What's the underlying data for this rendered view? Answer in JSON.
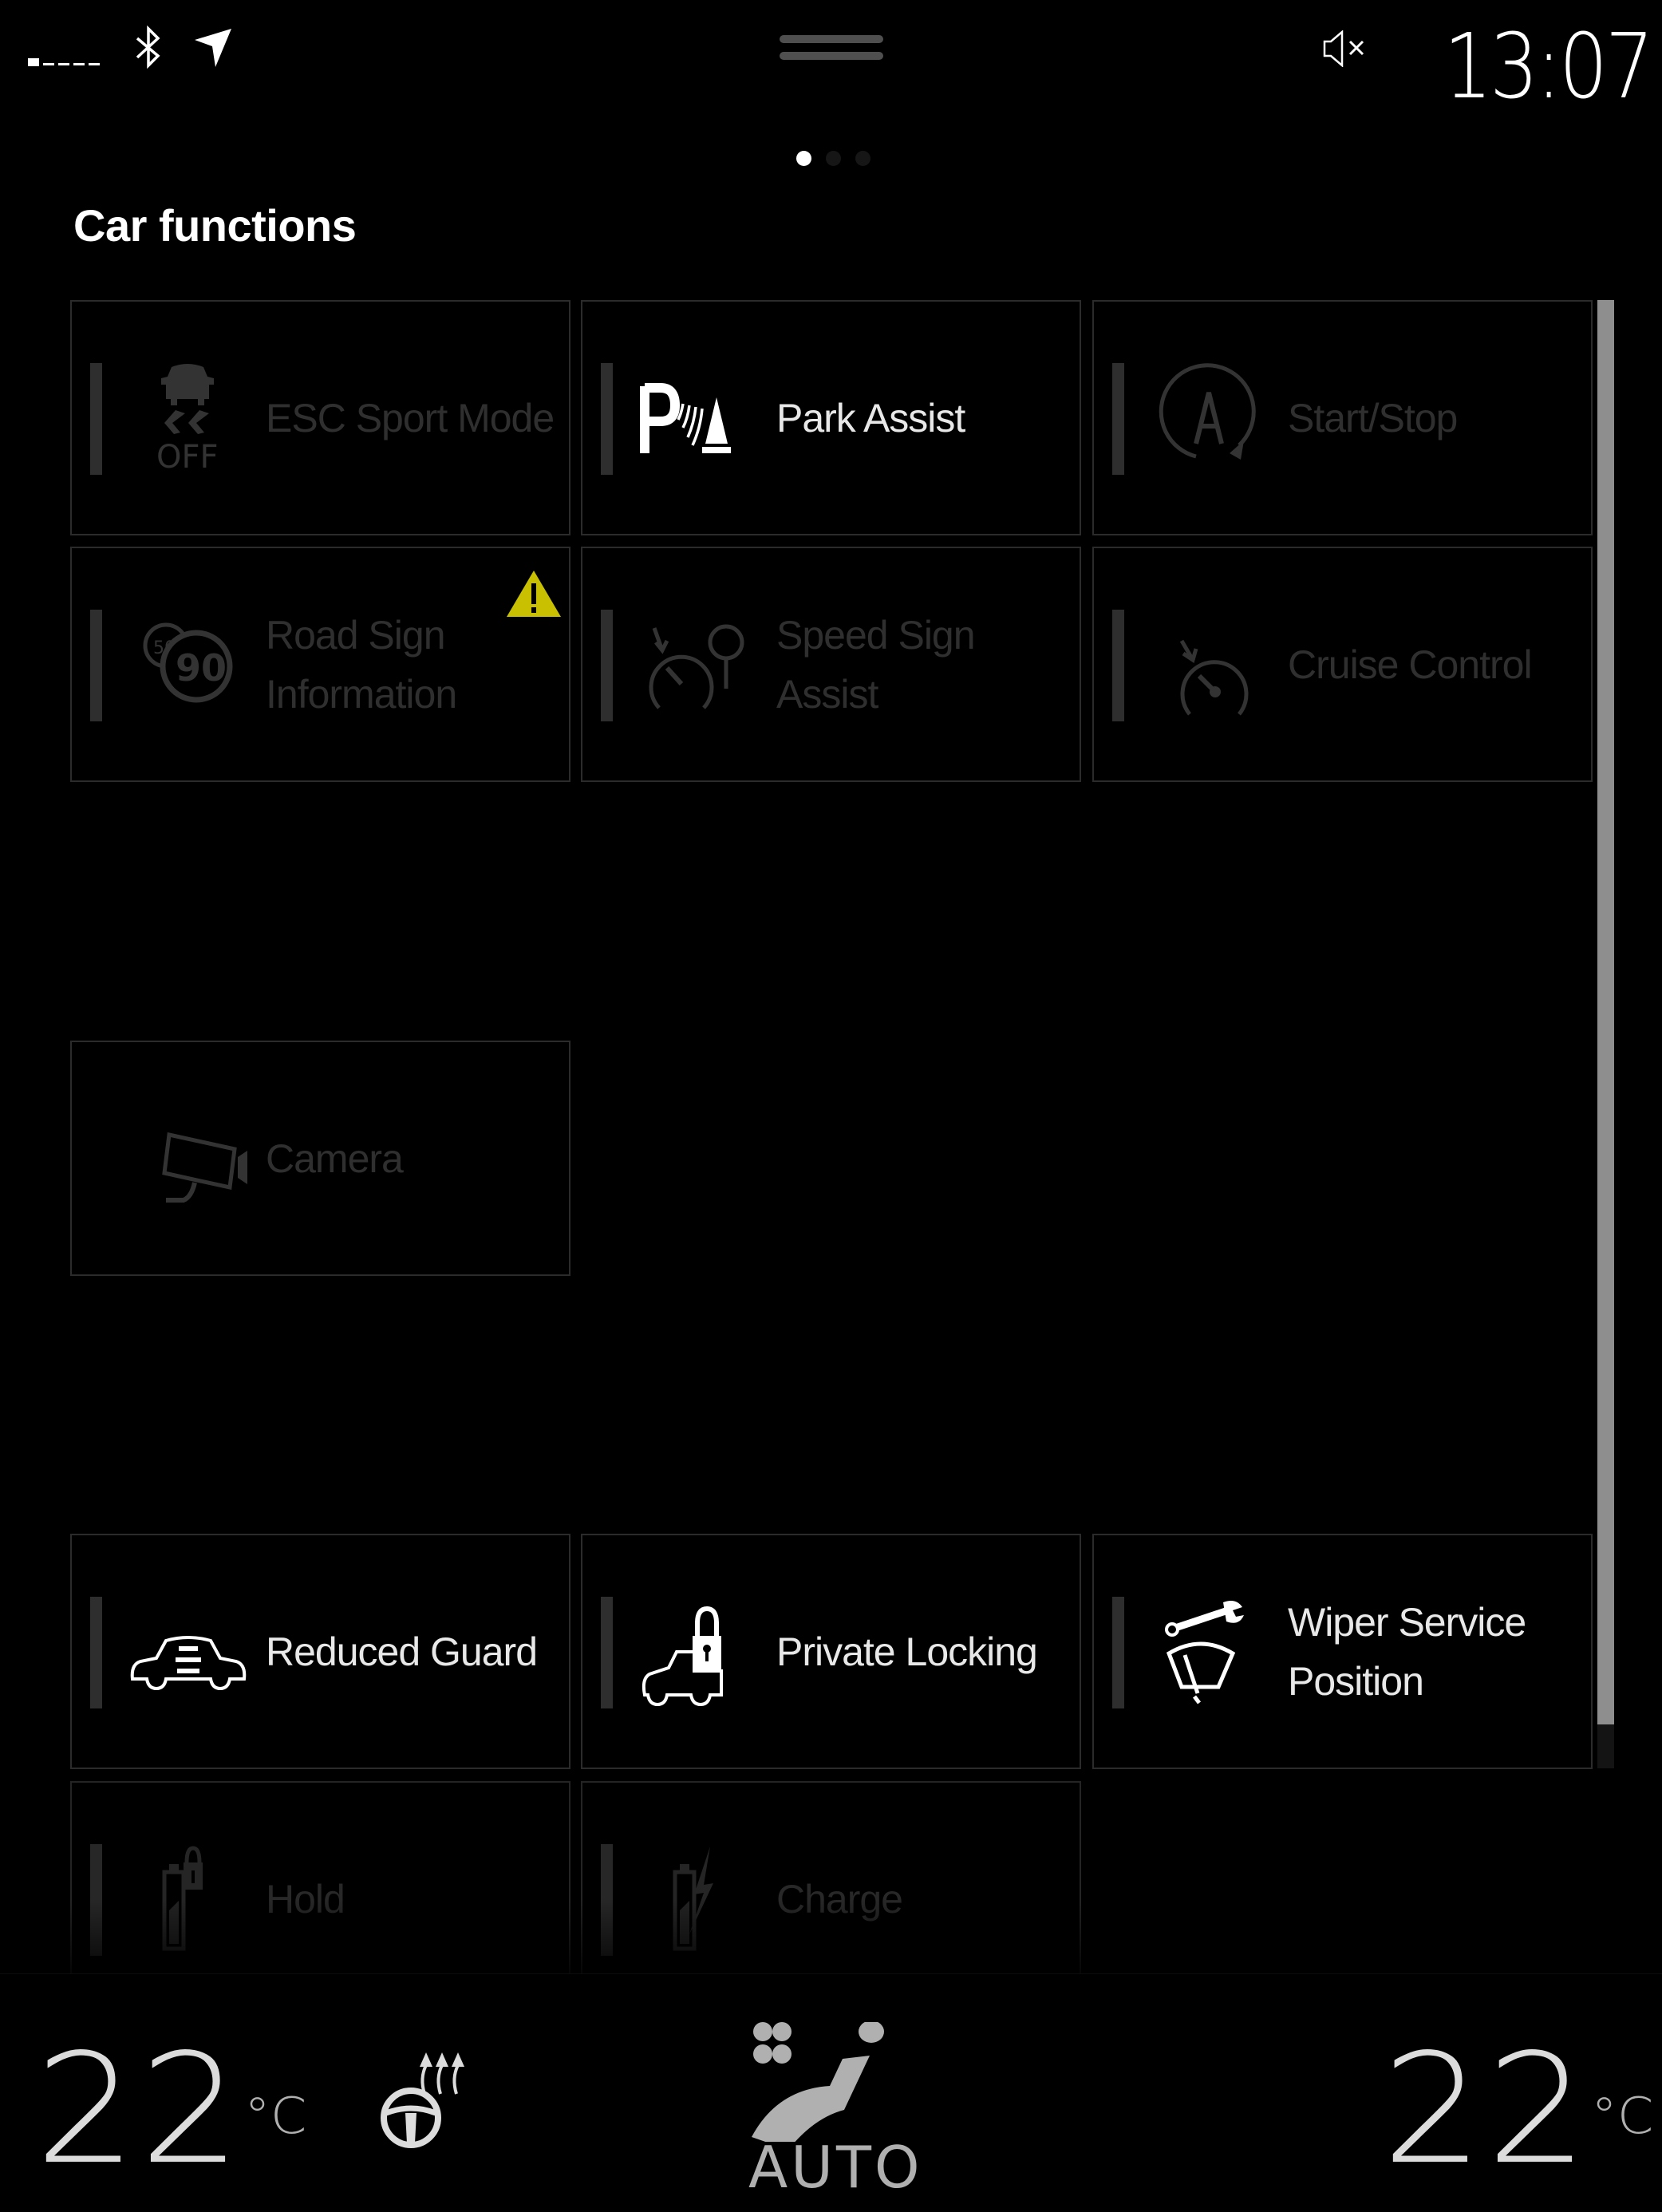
{
  "status_bar": {
    "signal_icon": "cellular-signal-none",
    "bluetooth_icon": "bluetooth-icon",
    "location_icon": "location-arrow-icon",
    "mute_icon": "speaker-muted-icon",
    "clock": "13:07"
  },
  "pager": {
    "pages": 3,
    "active_page": 1
  },
  "header": {
    "title": "Car functions"
  },
  "tiles": [
    {
      "label": "ESC Sport Mode",
      "icon": "esc-off-icon",
      "state": "disabled"
    },
    {
      "label": "Park Assist",
      "icon": "park-assist-icon",
      "state": "enabled"
    },
    {
      "label": "Start/Stop",
      "icon": "start-stop-icon",
      "state": "disabled"
    },
    {
      "label": "Road Sign\nInformation",
      "icon": "road-sign-icon",
      "state": "disabled",
      "warning": true
    },
    {
      "label": "Speed Sign\nAssist",
      "icon": "speed-sign-assist-icon",
      "state": "disabled"
    },
    {
      "label": "Cruise Control",
      "icon": "cruise-control-icon",
      "state": "disabled"
    },
    {
      "label": "Camera",
      "icon": "camera-icon",
      "state": "disabled"
    },
    {
      "label": "Reduced Guard",
      "icon": "reduced-guard-icon",
      "state": "enabled"
    },
    {
      "label": "Private Locking",
      "icon": "private-locking-icon",
      "state": "enabled"
    },
    {
      "label": "Wiper Service\nPosition",
      "icon": "wiper-service-icon",
      "state": "enabled"
    },
    {
      "label": "Hold",
      "icon": "battery-hold-icon",
      "state": "disabled"
    },
    {
      "label": "Charge",
      "icon": "battery-charge-icon",
      "state": "disabled"
    }
  ],
  "scroll": {
    "visible_fraction": 0.97,
    "position": 0
  },
  "climate": {
    "driver_temp": "22",
    "passenger_temp": "22",
    "unit": "°C",
    "heated_wheel_icon": "heated-steering-wheel-icon",
    "fan_icon": "fan-seat-icon",
    "fan_mode": "AUTO"
  },
  "colors": {
    "background": "#000000",
    "tile_border": "#2b2b2b",
    "disabled_text": "#2f2f2f",
    "enabled_text": "#e8e8e8",
    "warning": "#c8c000",
    "scroll_thumb": "#8e8e8e"
  }
}
